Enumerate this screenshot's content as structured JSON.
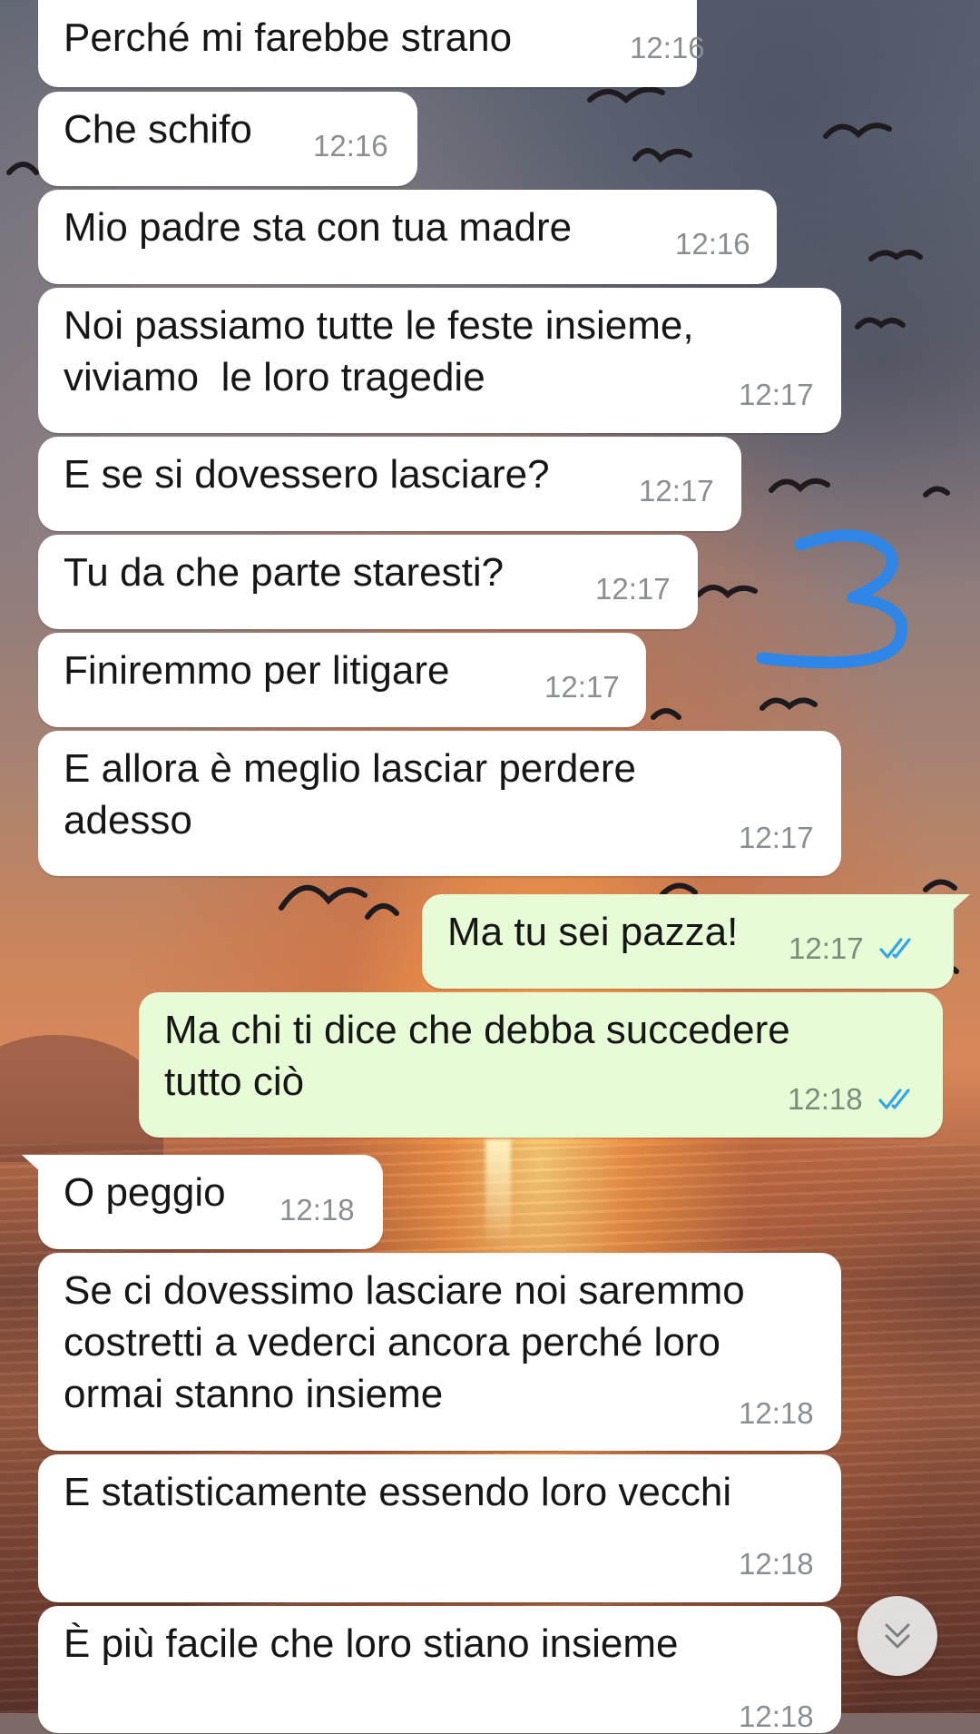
{
  "chat": {
    "messages": [
      {
        "dir": "in",
        "text": "Perché mi farebbe strano",
        "time": "12:16"
      },
      {
        "dir": "in",
        "text": "Che schifo",
        "time": "12:16"
      },
      {
        "dir": "in",
        "text": "Mio padre sta con tua madre",
        "time": "12:16"
      },
      {
        "dir": "in",
        "text": "Noi passiamo tutte le feste insieme,\nviviamo  le loro tragedie",
        "time": "12:17"
      },
      {
        "dir": "in",
        "text": "E se si dovessero lasciare?",
        "time": "12:17"
      },
      {
        "dir": "in",
        "text": "Tu da che parte staresti?",
        "time": "12:17"
      },
      {
        "dir": "in",
        "text": "Finiremmo per litigare",
        "time": "12:17"
      },
      {
        "dir": "in",
        "text": "E allora è meglio lasciar perdere\nadesso",
        "time": "12:17"
      },
      {
        "dir": "out",
        "text": "Ma tu sei pazza!",
        "time": "12:17",
        "status": "read"
      },
      {
        "dir": "out",
        "text": "Ma chi ti dice che debba succedere\ntutto ciò",
        "time": "12:18",
        "status": "read"
      },
      {
        "dir": "in",
        "text": "O peggio",
        "time": "12:18"
      },
      {
        "dir": "in",
        "text": "Se ci dovessimo lasciare noi saremmo\ncostretti a vederci ancora perché loro\normai stanno insieme",
        "time": "12:18"
      },
      {
        "dir": "in",
        "text": "E statisticamente essendo loro vecchi",
        "time": "12:18"
      },
      {
        "dir": "in",
        "text": "È più facile che loro stiano insieme",
        "time": "12:18"
      }
    ]
  },
  "annotation": {
    "mark": "3",
    "color": "#2f86e6"
  },
  "icons": {
    "read_receipt": "double-check-icon",
    "scroll_down": "double-chevron-down-icon"
  },
  "colors": {
    "incoming_bubble": "#ffffff",
    "outgoing_bubble": "#e7fcd6",
    "read_tick": "#34a6e8"
  }
}
